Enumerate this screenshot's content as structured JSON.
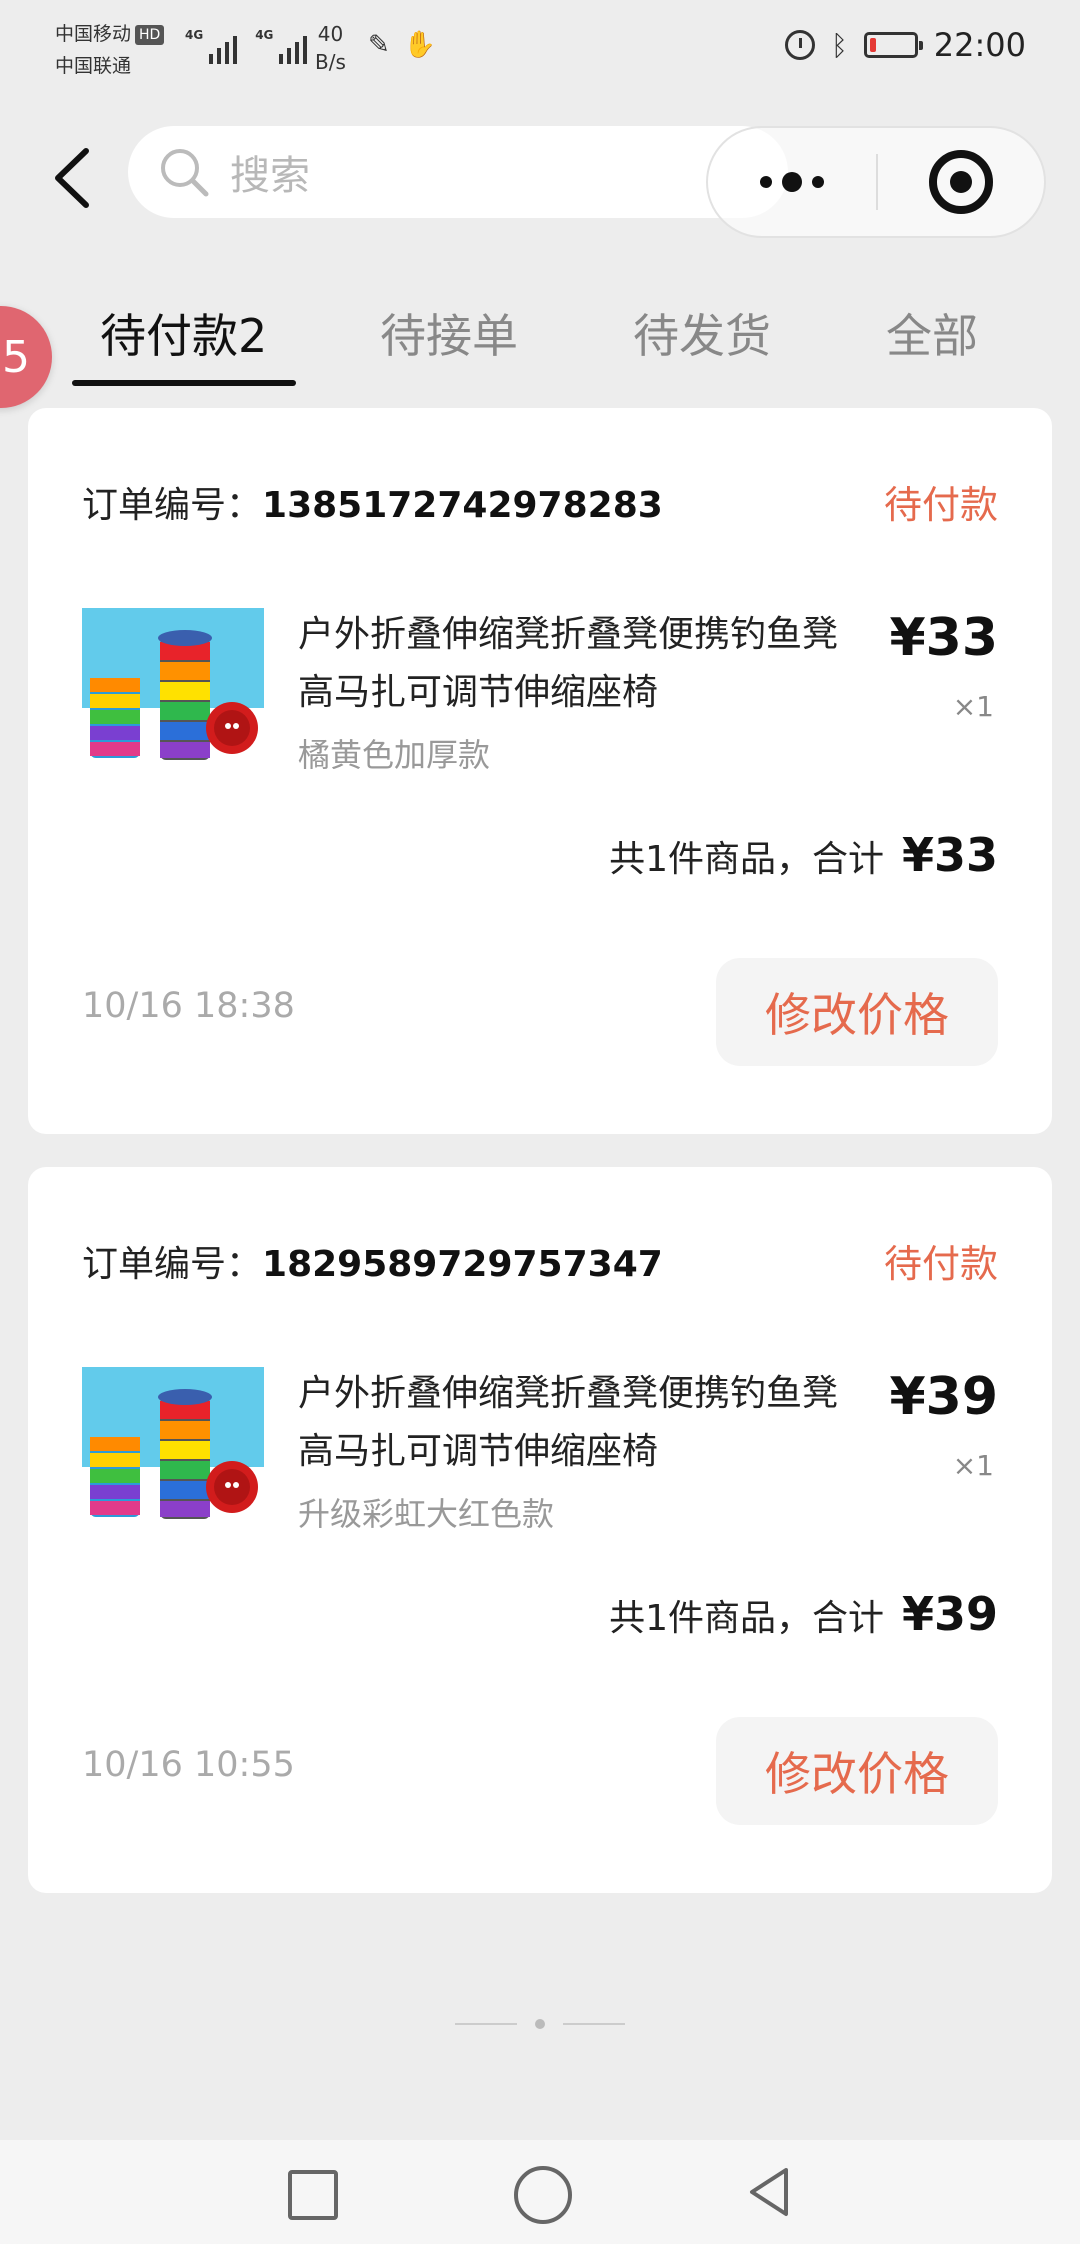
{
  "status_bar": {
    "carrier_1": "中国移动",
    "hd_badge": "HD",
    "carrier_2": "中国联通",
    "net_speed_value": "40",
    "net_speed_unit": "B/s",
    "signal_1_label": "4G",
    "signal_2_label": "4G",
    "time": "22:00",
    "battery_color": "#e53935",
    "icons": [
      "alarm-icon",
      "bluetooth-icon",
      "battery-icon"
    ]
  },
  "header": {
    "search_placeholder": "搜索",
    "icons": [
      "back-icon",
      "search-icon",
      "more-icon",
      "close-target-icon"
    ]
  },
  "tabs": [
    {
      "label": "待付款2",
      "active": true
    },
    {
      "label": "待接单",
      "active": false
    },
    {
      "label": "待发货",
      "active": false
    },
    {
      "label": "全部",
      "active": false
    }
  ],
  "floating_badge": "5",
  "orders": [
    {
      "number_label": "订单编号：",
      "number": "1385172742978283",
      "status": "待付款",
      "product": {
        "title": "户外折叠伸缩凳折叠凳便携钓鱼凳高马扎可调节伸缩座椅",
        "variant": "橘黄色加厚款",
        "price": "¥33",
        "quantity": "×1"
      },
      "total_label": "共1件商品，合计",
      "total_amount": "¥33",
      "time": "10/16 18:38",
      "action_label": "修改价格"
    },
    {
      "number_label": "订单编号：",
      "number": "1829589729757347",
      "status": "待付款",
      "product": {
        "title": "户外折叠伸缩凳折叠凳便携钓鱼凳高马扎可调节伸缩座椅",
        "variant": "升级彩虹大红色款",
        "price": "¥39",
        "quantity": "×1"
      },
      "total_label": "共1件商品，合计",
      "total_amount": "¥39",
      "time": "10/16 10:55",
      "action_label": "修改价格"
    }
  ],
  "colors": {
    "accent": "#e56a4d",
    "background": "#ededed",
    "badge": "#e06670"
  },
  "nav_bar": {
    "icons": [
      "recent-apps-icon",
      "home-icon",
      "back-nav-icon"
    ]
  }
}
